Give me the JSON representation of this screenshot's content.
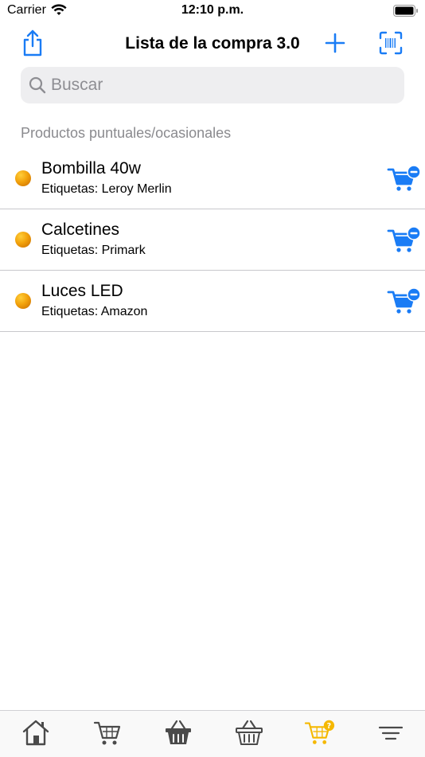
{
  "status_bar": {
    "carrier": "Carrier",
    "time": "12:10 p.m."
  },
  "nav": {
    "title": "Lista de la compra 3.0",
    "accent_color": "#1a7cf5"
  },
  "search": {
    "placeholder": "Buscar",
    "value": ""
  },
  "section": {
    "header": "Productos puntuales/ocasionales"
  },
  "items": [
    {
      "title": "Bombilla 40w",
      "tags": "Etiquetas: Leroy Merlin"
    },
    {
      "title": "Calcetines",
      "tags": "Etiquetas: Primark"
    },
    {
      "title": "Luces LED",
      "tags": "Etiquetas: Amazon"
    }
  ],
  "tab_bar": {
    "tabs": [
      {
        "icon": "home-icon",
        "selected": false
      },
      {
        "icon": "cart-icon",
        "selected": false
      },
      {
        "icon": "basket-icon",
        "selected": false
      },
      {
        "icon": "basket-outline-icon",
        "selected": false
      },
      {
        "icon": "cart-question-icon",
        "selected": true
      },
      {
        "icon": "menu-icon",
        "selected": false
      }
    ],
    "selected_color": "#f5b800",
    "icon_color": "#4a4a4a"
  }
}
